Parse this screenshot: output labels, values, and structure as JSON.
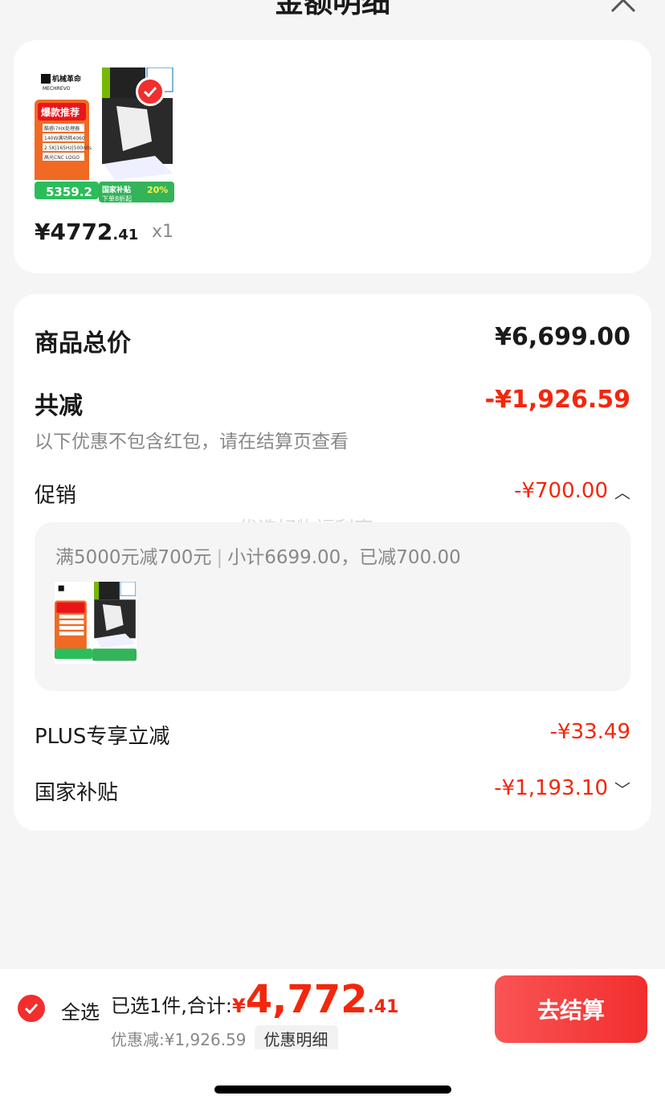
{
  "header": {
    "title": "金额明细"
  },
  "product": {
    "brand": "机械革命",
    "brand_sub": "MECHREVO",
    "badge_text": "爆款推荐",
    "spec_lines": [
      "酷睿i7HX处理器",
      "140W满功耗4060",
      "2.5K|165Hz|500nits",
      "高光CNC LOGO"
    ],
    "promo_price": "5359.2",
    "subsidy_label": "国家补贴",
    "subsidy_rate": "20%",
    "subsidy_sub": "下单8折起",
    "price_int": "¥4772",
    "price_dec": ".41",
    "qty": "x1"
  },
  "detail": {
    "total_label": "商品总价",
    "total_value": "¥6,699.00",
    "reduce_label": "共减",
    "reduce_value": "-¥1,926.59",
    "reduce_note": "以下优惠不包含红包，请在结算页查看",
    "promo_label": "促销",
    "promo_value": "-¥700.00",
    "promo_rule": "满5000元减700元",
    "promo_subtotal": "小计6699.00，已减700.00",
    "plus_label": "PLUS专享立减",
    "plus_value": "-¥33.49",
    "subsidy_label": "国家补贴",
    "subsidy_value": "-¥1,193.10",
    "watermark": "优选好物福利官"
  },
  "bottom": {
    "select_all": "全选",
    "summary_prefix": "已选1件,合计:",
    "currency": "¥",
    "total_int": "4,772",
    "total_dec": ".41",
    "discount_text": "优惠减:¥1,926.59",
    "discount_detail": "优惠明细",
    "checkout": "去结算"
  },
  "colors": {
    "accent": "#f2270c",
    "check": "#f22e2e",
    "bg": "#f5f5f5"
  }
}
